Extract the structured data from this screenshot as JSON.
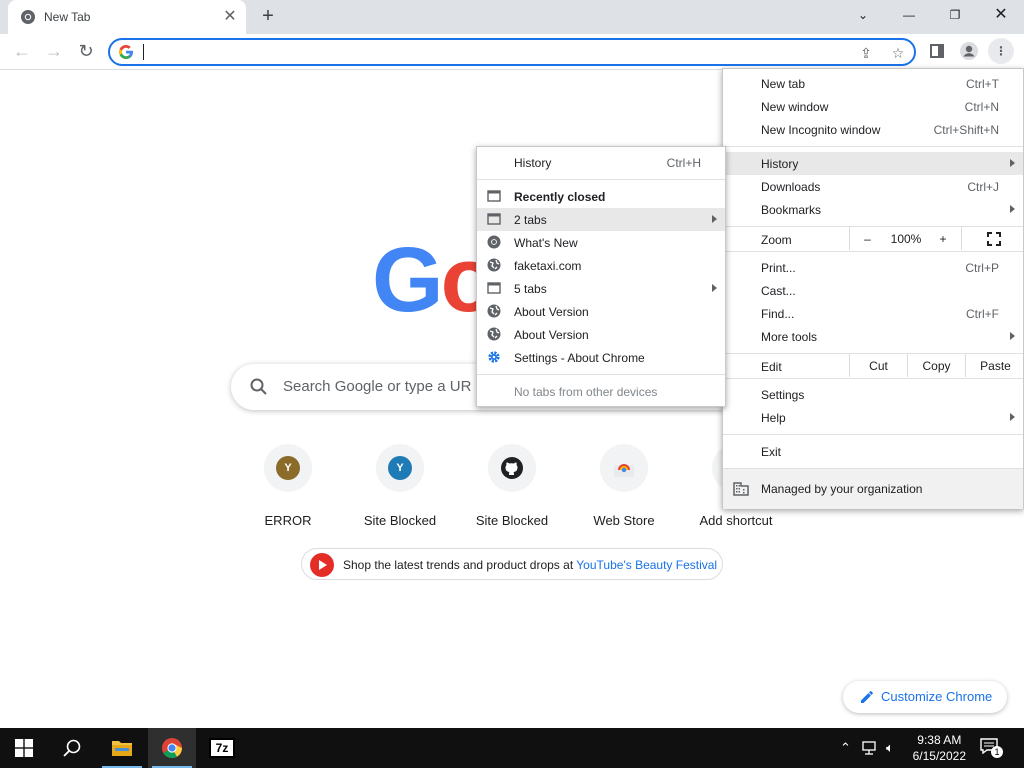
{
  "browser": {
    "tab_title": "New Tab",
    "omnibox_value": "",
    "window_controls": [
      "minimize",
      "restore",
      "close"
    ]
  },
  "ntp": {
    "logo_letters": [
      "G",
      "o"
    ],
    "search_placeholder": "Search Google or type a URL",
    "search_placeholder_visible": "Search Google or type a UR",
    "shortcuts": [
      {
        "label": "ERROR",
        "initial": "Y",
        "color": "#8b6b2a"
      },
      {
        "label": "Site Blocked",
        "initial": "Y",
        "color": "#1f7bb6"
      },
      {
        "label": "Site Blocked",
        "initial": "",
        "color": "#202124"
      },
      {
        "label": "Web Store",
        "initial": "",
        "color": ""
      },
      {
        "label": "Add shortcut",
        "initial": "",
        "color": ""
      }
    ],
    "promo_text": "Shop the latest trends and product drops at ",
    "promo_link": "YouTube's Beauty Festival",
    "customize_label": "Customize Chrome"
  },
  "main_menu": {
    "items": {
      "new_tab": {
        "label": "New tab",
        "shortcut": "Ctrl+T"
      },
      "new_window": {
        "label": "New window",
        "shortcut": "Ctrl+N"
      },
      "incognito": {
        "label": "New Incognito window",
        "shortcut": "Ctrl+Shift+N"
      },
      "history": {
        "label": "History"
      },
      "downloads": {
        "label": "Downloads",
        "shortcut": "Ctrl+J"
      },
      "bookmarks": {
        "label": "Bookmarks"
      },
      "zoom": {
        "label": "Zoom",
        "minus": "–",
        "value": "100%",
        "plus": "+"
      },
      "print": {
        "label": "Print...",
        "shortcut": "Ctrl+P"
      },
      "cast": {
        "label": "Cast..."
      },
      "find": {
        "label": "Find...",
        "shortcut": "Ctrl+F"
      },
      "more_tools": {
        "label": "More tools"
      },
      "edit": {
        "label": "Edit",
        "cut": "Cut",
        "copy": "Copy",
        "paste": "Paste"
      },
      "settings": {
        "label": "Settings"
      },
      "help": {
        "label": "Help"
      },
      "exit": {
        "label": "Exit"
      },
      "managed": {
        "label": "Managed by your organization"
      }
    }
  },
  "history_menu": {
    "history": {
      "label": "History",
      "shortcut": "Ctrl+H"
    },
    "recently_closed": "Recently closed",
    "entries": [
      {
        "label": "2 tabs",
        "icon": "window-icon"
      },
      {
        "label": "What's New",
        "icon": "chrome-icon"
      },
      {
        "label": "faketaxi.com",
        "icon": "globe-icon"
      },
      {
        "label": "5 tabs",
        "icon": "window-icon"
      },
      {
        "label": "About Version",
        "icon": "globe-icon"
      },
      {
        "label": "About Version",
        "icon": "globe-icon"
      },
      {
        "label": "Settings - About Chrome",
        "icon": "gear-icon"
      }
    ],
    "no_tabs": "No tabs from other devices"
  },
  "taskbar": {
    "time": "9:38 AM",
    "date": "6/15/2022",
    "notifications": "1",
    "apps": [
      "start-icon",
      "search-icon",
      "file-explorer-icon",
      "chrome-icon",
      "7zip-icon"
    ]
  },
  "colors": {
    "accent": "#1a73e8",
    "google_blue": "#4285f4",
    "google_red": "#ea4335"
  }
}
